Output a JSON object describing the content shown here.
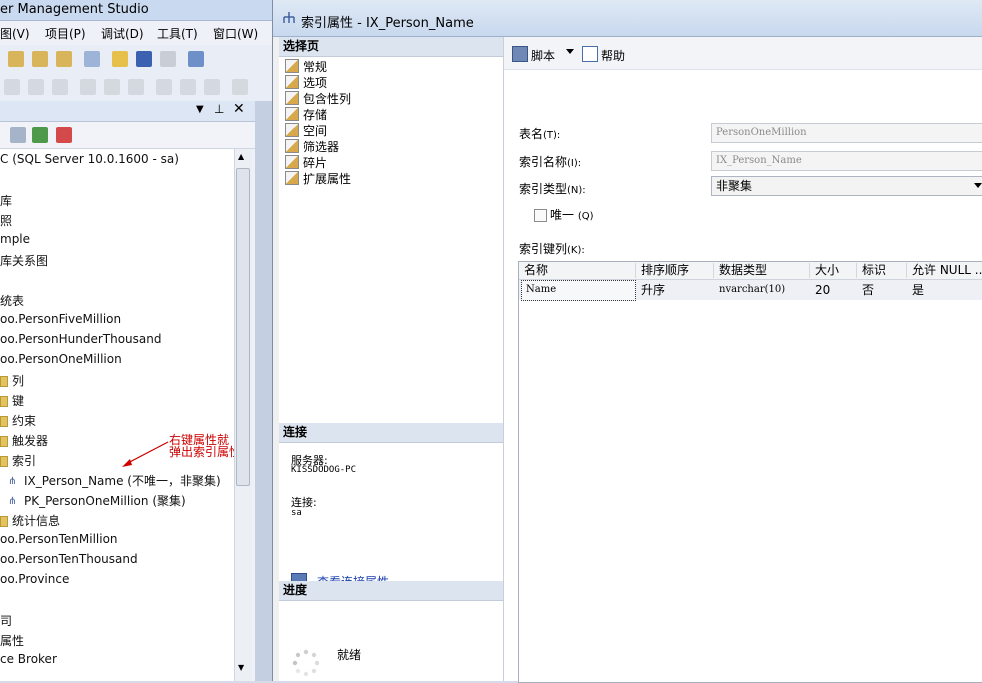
{
  "ssms": {
    "title": "er Management Studio",
    "menu": [
      "图(V)",
      "项目(P)",
      "调试(D)",
      "工具(T)",
      "窗口(W)"
    ],
    "tree": [
      "C (SQL Server 10.0.1600 - sa)",
      "库",
      "照",
      "mple",
      "库关系图",
      "统表",
      "oo.PersonFiveMillion",
      "oo.PersonHunderThousand",
      "oo.PersonOneMillion",
      "列",
      "键",
      "约束",
      "触发器",
      "索引",
      "IX_Person_Name (不唯一，非聚集)",
      "PK_PersonOneMillion (聚集)",
      "统计信息",
      "oo.PersonTenMillion",
      "oo.PersonTenThousand",
      "oo.Province",
      "司",
      "属性",
      "ce Broker"
    ],
    "annotation_line1": "右键属性就",
    "annotation_line2": "弹出索引属性框"
  },
  "dialog": {
    "title": "索引属性 - IX_Person_Name",
    "nav": {
      "header": "选择页",
      "pages": [
        "常规",
        "选项",
        "包含性列",
        "存储",
        "空间",
        "筛选器",
        "碎片",
        "扩展属性"
      ]
    },
    "connection": {
      "header": "连接",
      "server_label": "服务器:",
      "server_value": "KISSDODOG-PC",
      "conn_label": "连接:",
      "conn_value": "sa",
      "link": "查看连接属性"
    },
    "progress": {
      "header": "进度",
      "status": "就绪"
    },
    "toolbar": {
      "script": "脚本",
      "help": "帮助"
    },
    "form": {
      "table_name_label": "表名",
      "table_name_key": "(T):",
      "table_name_value": "PersonOneMillion",
      "index_name_label": "索引名称",
      "index_name_key": "(I):",
      "index_name_value": "IX_Person_Name",
      "index_type_label": "索引类型",
      "index_type_key": "(N):",
      "index_type_value": "非聚集",
      "unique_label": "唯一",
      "unique_key": "(Q)",
      "unique_checked": false,
      "key_columns_label": "索引键列",
      "key_columns_key": "(K):"
    },
    "grid": {
      "columns": [
        "名称",
        "排序顺序",
        "数据类型",
        "大小",
        "标识",
        "允许 NULL ..."
      ],
      "rows": [
        [
          "Name",
          "升序",
          "nvarchar(10)",
          "20",
          "否",
          "是"
        ]
      ]
    }
  }
}
